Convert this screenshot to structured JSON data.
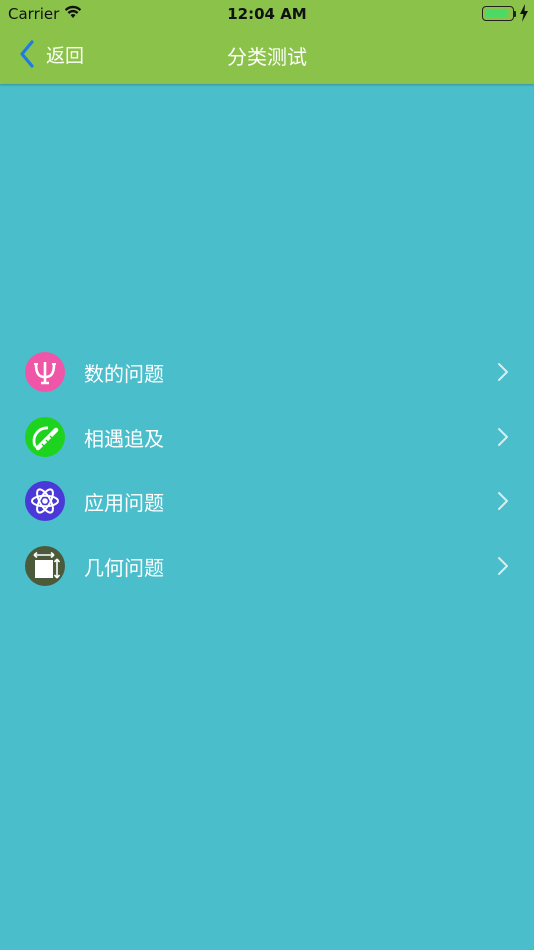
{
  "status_bar": {
    "carrier": "Carrier",
    "time": "12:04 AM",
    "battery_level": 0.85
  },
  "nav": {
    "back_label": "返回",
    "title": "分类测试"
  },
  "colors": {
    "nav_background": "#8BC34A",
    "page_background": "#4ABECB",
    "back_chevron": "#1E7BE6"
  },
  "categories": [
    {
      "label": "数的问题",
      "icon": "psi-icon",
      "icon_color": "#F056A8"
    },
    {
      "label": "相遇追及",
      "icon": "protractor-ruler-icon",
      "icon_color": "#1ED31E"
    },
    {
      "label": "应用问题",
      "icon": "atom-icon",
      "icon_color": "#4A38D8"
    },
    {
      "label": "几何问题",
      "icon": "resize-square-icon",
      "icon_color": "#4A5A3A"
    }
  ]
}
